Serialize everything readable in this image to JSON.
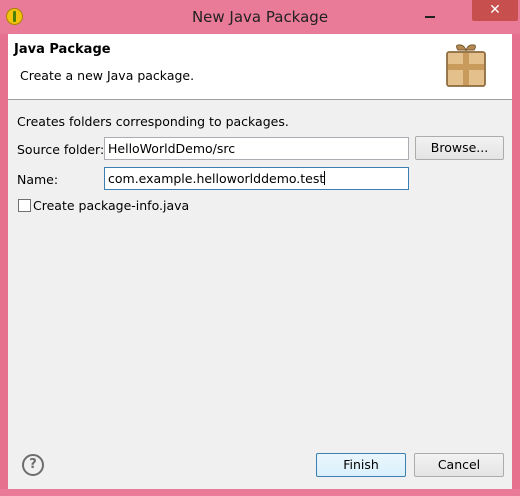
{
  "window": {
    "title": "New Java Package",
    "minimize_glyph": "",
    "close_glyph": "✕",
    "frame_color": "#ea7b98",
    "app_icon": "eclipse-icon"
  },
  "header": {
    "title": "Java Package",
    "description": "Create a new Java package.",
    "icon": "package-icon"
  },
  "form": {
    "description": "Creates folders corresponding to packages.",
    "source_folder_label": "Source folder:",
    "source_folder_value": "HelloWorldDemo/src",
    "browse_label": "Browse...",
    "name_label": "Name:",
    "name_value": "com.example.helloworlddemo.test",
    "checkbox_label": "Create package-info.java",
    "checkbox_checked": false
  },
  "footer": {
    "help_glyph": "?",
    "finish_label": "Finish",
    "cancel_label": "Cancel"
  }
}
